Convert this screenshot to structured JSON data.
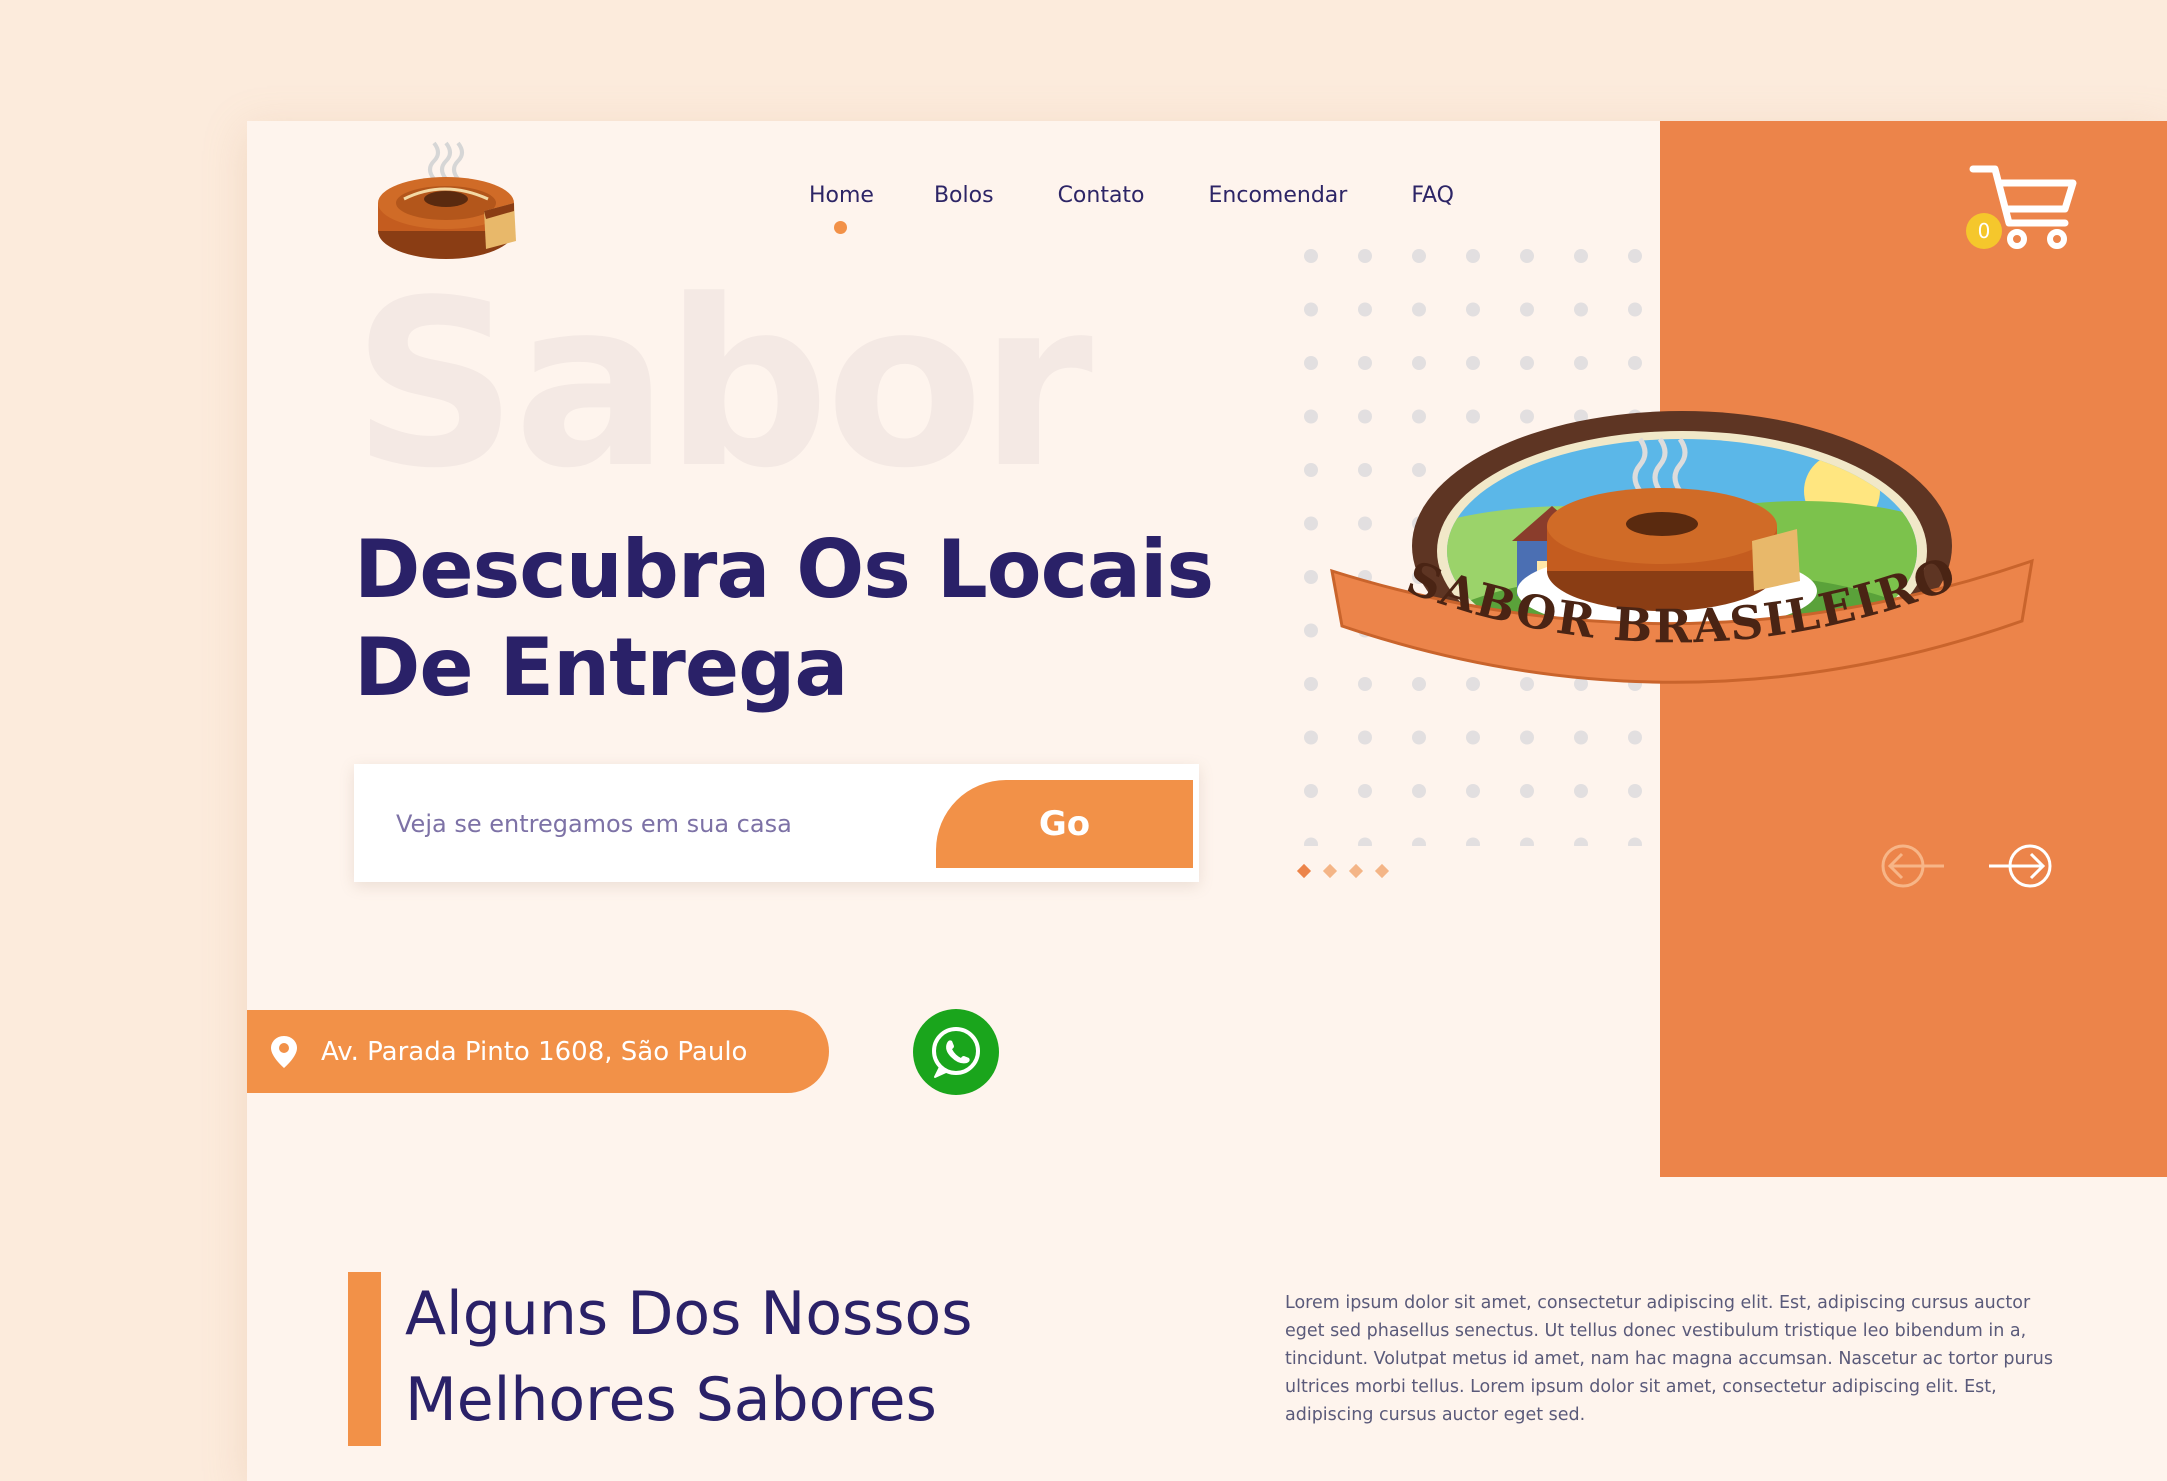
{
  "nav": {
    "items": [
      {
        "label": "Home",
        "active": true
      },
      {
        "label": "Bolos",
        "active": false
      },
      {
        "label": "Contato",
        "active": false
      },
      {
        "label": "Encomendar",
        "active": false
      },
      {
        "label": "FAQ",
        "active": false
      }
    ]
  },
  "cart": {
    "count": "0",
    "icon": "cart-icon"
  },
  "hero": {
    "ghost_word": "Sabor",
    "title_line1": "Descubra Os Locais",
    "title_line2": "De Entrega"
  },
  "search": {
    "placeholder": "Veja se entregamos em sua casa",
    "button_label": "Go"
  },
  "brand_badge": {
    "text": "SABOR BRASILEIRO"
  },
  "slider": {
    "total": 4,
    "active_index": 0
  },
  "address": {
    "text": "Av. Parada Pinto 1608, São Paulo",
    "icon": "location-pin-icon"
  },
  "whatsapp": {
    "icon": "whatsapp-icon"
  },
  "section": {
    "title_line1": "Alguns Dos Nossos",
    "title_line2": "Melhores Sabores",
    "body": "Lorem ipsum dolor sit amet, consectetur adipiscing elit. Est, adipiscing cursus auctor eget sed phasellus senectus. Ut tellus donec vestibulum tristique leo bibendum in a, tincidunt. Volutpat metus id amet, nam hac magna accumsan. Nascetur ac tortor purus ultrices morbi tellus. Lorem ipsum dolor sit amet, consectetur adipiscing elit. Est, adipiscing cursus auctor eget sed."
  },
  "colors": {
    "background": "#fcebdc",
    "card": "#fef4ed",
    "accent": "#ec844a",
    "button": "#f29148",
    "navy": "#2a2168",
    "whatsapp": "#1aa51c"
  }
}
